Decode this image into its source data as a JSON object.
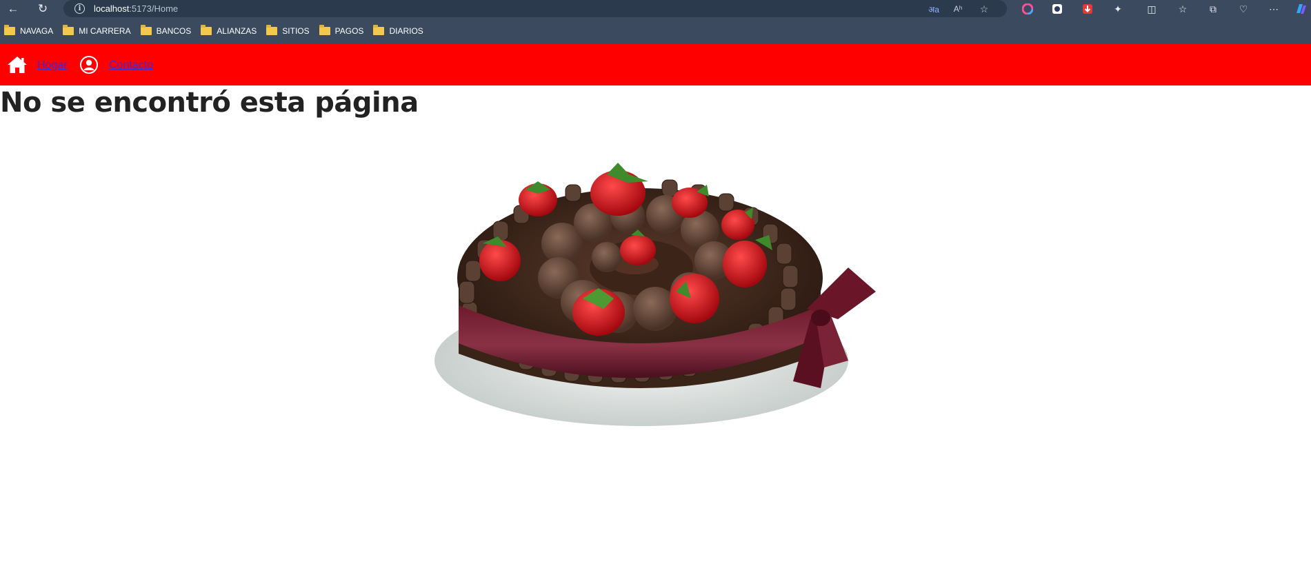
{
  "browser": {
    "url_host": "localhost",
    "url_path": ":5173/Home",
    "bookmarks": [
      "NAVAGA",
      "MI CARRERA",
      "BANCOS",
      "ALIANZAS",
      "SITIOS",
      "PAGOS",
      "DIARIOS"
    ]
  },
  "navbar": {
    "bg_color": "#ff0000",
    "links": [
      {
        "label": "Hogar",
        "icon": "home-icon"
      },
      {
        "label": "Contacto",
        "icon": "user-circle-icon"
      }
    ]
  },
  "main": {
    "title": "No se encontró esta página",
    "image": "chocolate-strawberry-cake-image"
  }
}
